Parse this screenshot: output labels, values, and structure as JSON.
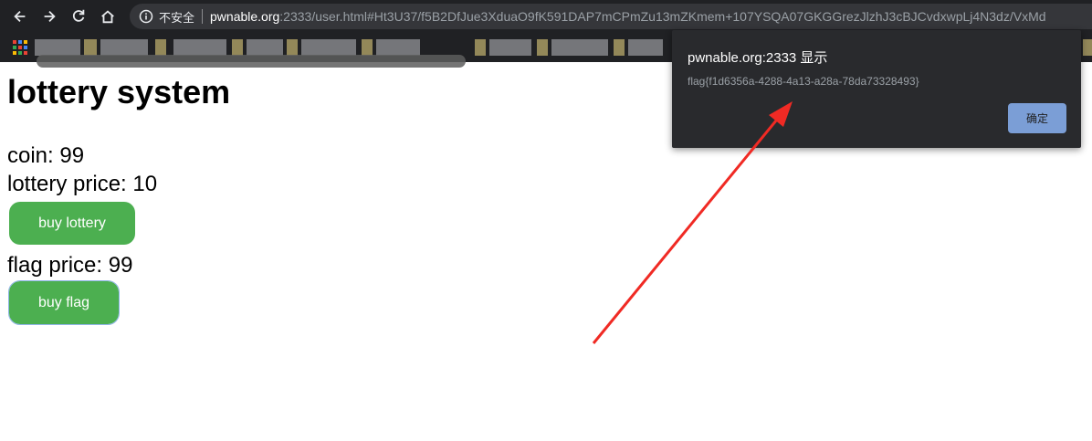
{
  "browser": {
    "security_label": "不安全",
    "url_host": "pwnable.org",
    "url_rest": ":2333/user.html#Ht3U37/f5B2DfJue3XduaO9fK591DAP7mCPmZu13mZKmem+107YSQA07GKGGrezJlzhJ3cBJCvdxwpLj4N3dz/VxMd"
  },
  "page": {
    "title": "lottery system",
    "coin_label": "coin: 99",
    "lottery_price_label": "lottery price: 10",
    "buy_lottery_label": "buy lottery",
    "flag_price_label": "flag price: 99",
    "buy_flag_label": "buy flag"
  },
  "dialog": {
    "title": "pwnable.org:2333 显示",
    "message": "flag{f1d6356a-4288-4a13-a28a-78da73328493}",
    "ok_label": "确定"
  },
  "colors": {
    "button_green": "#4caf50",
    "annotation_arrow": "#f02a24",
    "dialog_bg": "#292a2d",
    "dialog_ok": "#7b9ed6"
  }
}
